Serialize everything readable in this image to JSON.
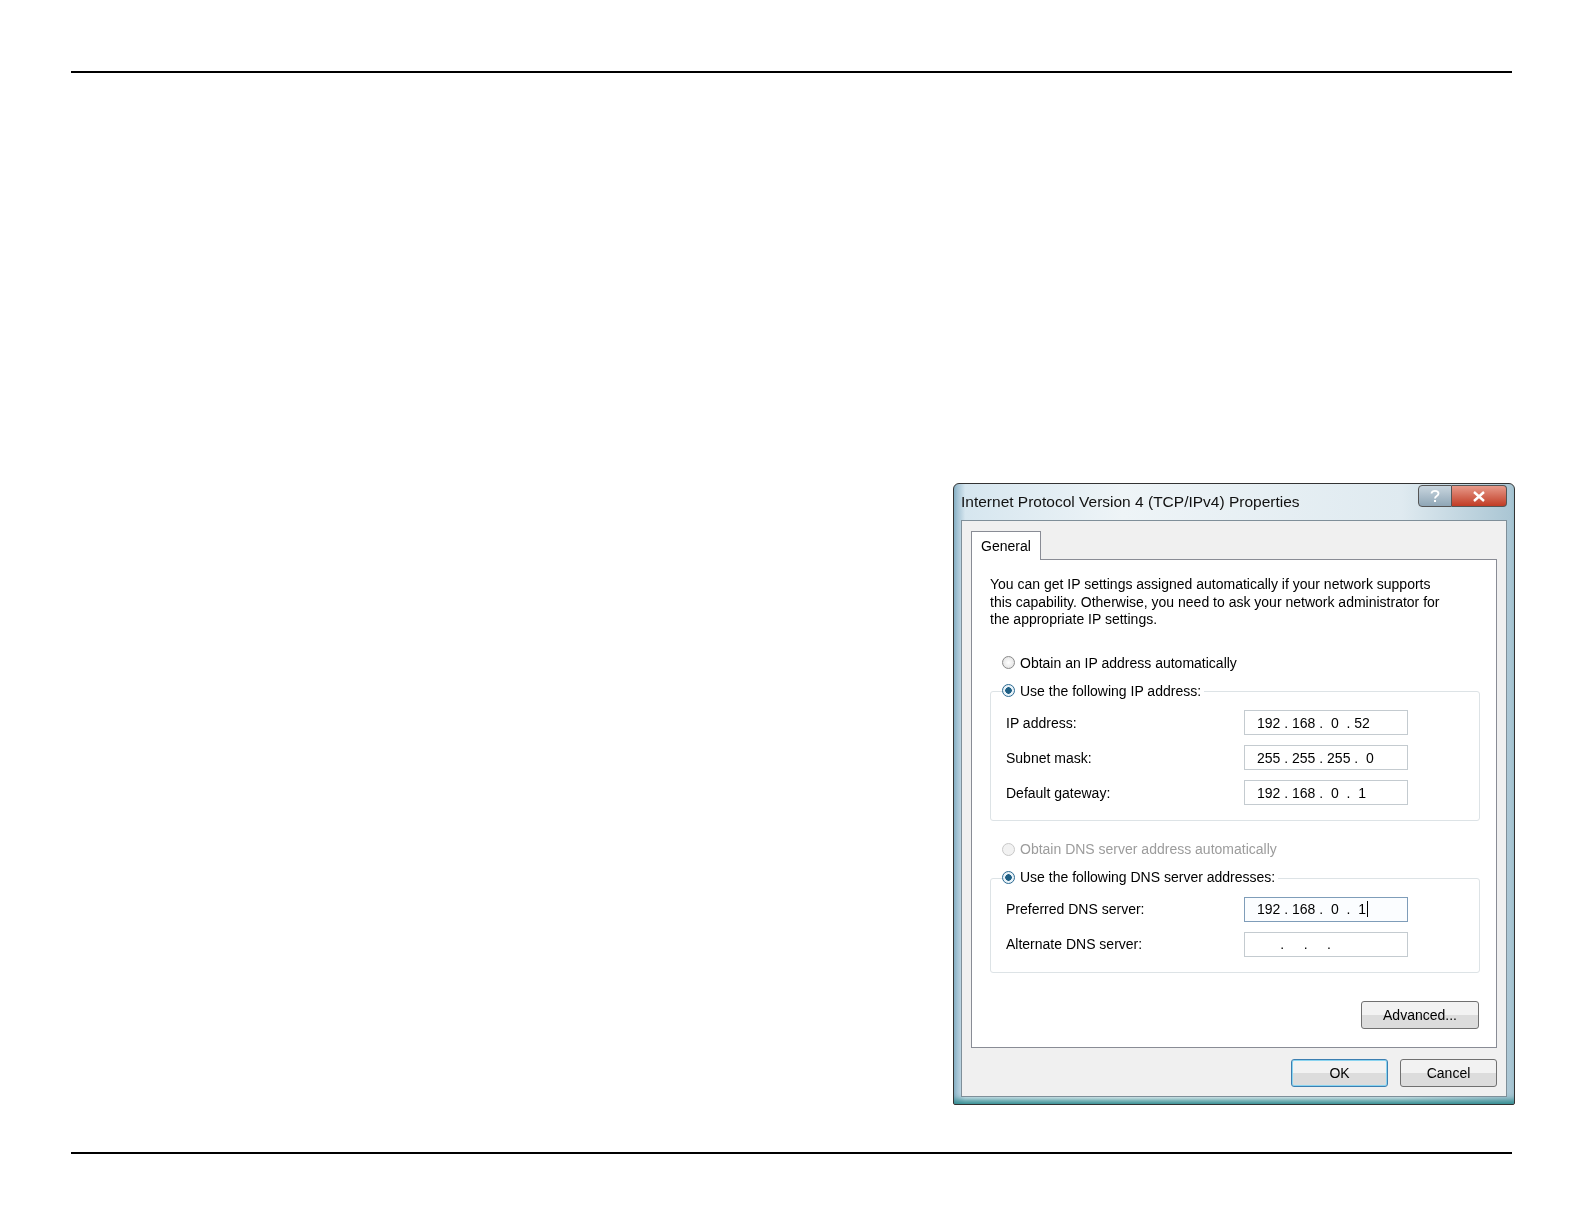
{
  "window": {
    "title": "Internet Protocol Version 4 (TCP/IPv4) Properties"
  },
  "tabs": [
    {
      "label": "General",
      "selected": true
    }
  ],
  "description": "You can get IP settings assigned automatically if your network supports this capability. Otherwise, you need to ask your network administrator for the appropriate IP settings.",
  "sections": [
    {
      "auto_option": {
        "label": "Obtain an IP address automatically",
        "selected": false,
        "disabled": false
      },
      "manual_option": {
        "label": "Use the following IP address:",
        "selected": true,
        "disabled": false
      },
      "fields": [
        {
          "label": "IP address:",
          "value": "192 . 168 .  0  . 52",
          "focused": false
        },
        {
          "label": "Subnet mask:",
          "value": "255 . 255 . 255 .  0",
          "focused": false
        },
        {
          "label": "Default gateway:",
          "value": "192 . 168 .  0  .  1",
          "focused": false
        }
      ]
    },
    {
      "auto_option": {
        "label": "Obtain DNS server address automatically",
        "selected": false,
        "disabled": true
      },
      "manual_option": {
        "label": "Use the following DNS server addresses:",
        "selected": true,
        "disabled": false
      },
      "fields": [
        {
          "label": "Preferred DNS server:",
          "value": "192 . 168 .  0  .  1",
          "focused": true
        },
        {
          "label": "Alternate DNS server:",
          "value": "      .     .     .",
          "focused": false
        }
      ]
    }
  ],
  "advanced_button": "Advanced...",
  "buttons": [
    {
      "label": "OK",
      "default": true
    },
    {
      "label": "Cancel",
      "default": false
    }
  ]
}
